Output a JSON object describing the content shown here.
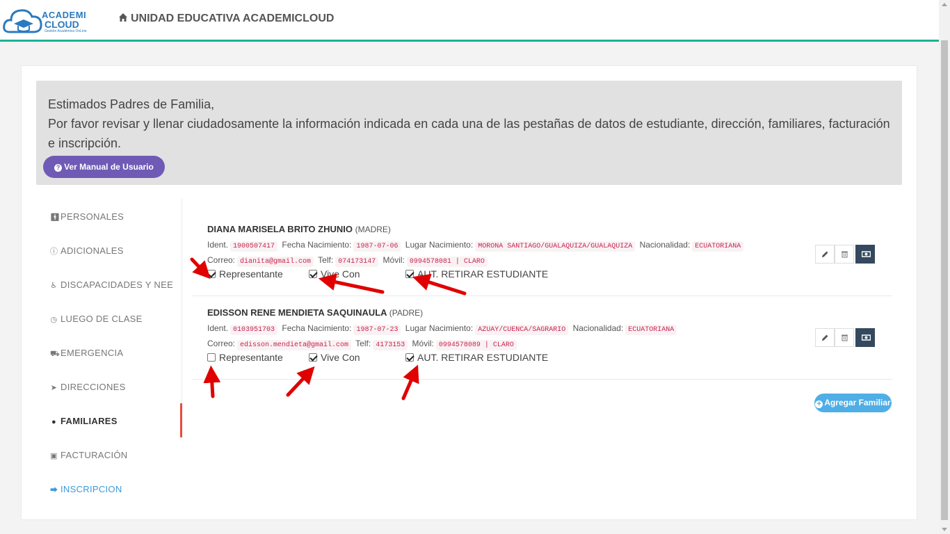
{
  "header": {
    "logo_line1": "ACADEMI",
    "logo_line2": "CLOUD",
    "logo_sub": "Gestión Académica OnLine",
    "title": "UNIDAD EDUCATIVA ACADEMICLOUD"
  },
  "notice": {
    "line1": "Estimados Padres de Familia,",
    "line2": "Por favor revisar y llenar ciudadosamente la información indicada en cada una de las pestañas de datos de estudiante, dirección, familiares, facturación e inscripción.",
    "manual_button": "Ver Manual de Usuario"
  },
  "sidebar": {
    "items": [
      {
        "label": "PERSONALES",
        "icon": "male-icon"
      },
      {
        "label": "ADICIONALES",
        "icon": "info-icon"
      },
      {
        "label": "DISCAPACIDADES Y NEE",
        "icon": "wheelchair-icon"
      },
      {
        "label": "LUEGO DE CLASE",
        "icon": "clock-icon"
      },
      {
        "label": "EMERGENCIA",
        "icon": "ambulance-icon"
      },
      {
        "label": "DIRECCIONES",
        "icon": "location-arrow-icon"
      },
      {
        "label": "FAMILIARES",
        "icon": "users-icon"
      },
      {
        "label": "FACTURACIÓN",
        "icon": "money-icon"
      },
      {
        "label": "INSCRIPCION",
        "icon": "arrow-circle-icon"
      }
    ],
    "active": "FAMILIARES"
  },
  "labels": {
    "ident": "Ident.",
    "fecha": "Fecha Nacimiento:",
    "lugar": "Lugar Nacimiento:",
    "nacionalidad": "Nacionalidad:",
    "correo": "Correo:",
    "telf": "Telf:",
    "movil": "Móvil:",
    "representante": "Representante",
    "vive_con": "Vive Con",
    "aut_retirar": "AUT. RETIRAR ESTUDIANTE"
  },
  "familiares": [
    {
      "name": "DIANA MARISELA BRITO ZHUNIO",
      "relation": "(MADRE)",
      "ident": "1900507417",
      "fecha": "1987-07-06",
      "lugar": "MORONA SANTIAGO/GUALAQUIZA/GUALAQUIZA",
      "nacionalidad": "ECUATORIANA",
      "correo": "dianita@gmail.com",
      "telf": "074173147",
      "movil": "0994578081 | CLARO",
      "representante": true,
      "vive_con": true,
      "aut_retirar": true
    },
    {
      "name": "EDISSON RENE MENDIETA SAQUINAULA",
      "relation": "(PADRE)",
      "ident": "0103951703",
      "fecha": "1987-07-23",
      "lugar": "AZUAY/CUENCA/SAGRARIO",
      "nacionalidad": "ECUATORIANA",
      "correo": "edisson.mendieta@gmail.com",
      "telf": "4173153",
      "movil": "0994578089 | CLARO",
      "representante": false,
      "vive_con": true,
      "aut_retirar": true
    }
  ],
  "add_button": "Agregar Familiar",
  "colors": {
    "accent_green": "#1ab394",
    "purple_button": "#6f5bb5",
    "blue_button": "#4faee6",
    "active_marker": "#e74c3c",
    "annotation_arrow": "#e00000"
  }
}
